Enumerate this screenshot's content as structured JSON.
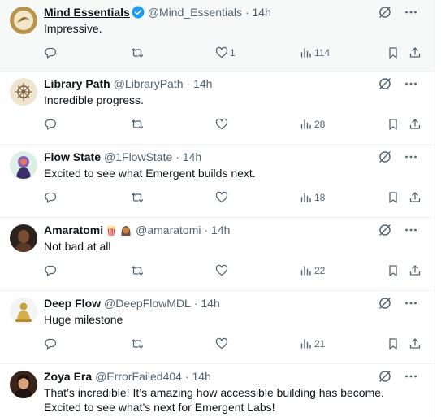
{
  "replies": [
    {
      "name": "Mind Essentials",
      "handle": "@Mind_Essentials",
      "time": "· 14h",
      "text": "Impressive.",
      "likes": "1",
      "views": "114",
      "verified": true
    },
    {
      "name": "Library Path",
      "handle": "@LibraryPath",
      "time": "· 14h",
      "text": "Incredible progress.",
      "likes": "",
      "views": "28"
    },
    {
      "name": "Flow State",
      "handle": "@1FlowState",
      "time": "· 14h",
      "text": "Excited to see what Emergent builds next.",
      "likes": "",
      "views": "18"
    },
    {
      "name": "Amaratomi",
      "handle": "@amaratomi",
      "time": "· 14h",
      "text": "Not bad at all",
      "likes": "",
      "views": "22"
    },
    {
      "name": "Deep Flow",
      "handle": "@DeepFlowMDL",
      "time": "· 14h",
      "text": "Huge milestone",
      "likes": "",
      "views": "21"
    },
    {
      "name": "Zoya Era",
      "handle": "@ErrorFailed404",
      "time": "· 14h",
      "text": "That’s incredible! It’s amazing how accessible building has become. Excited to see what’s next for Emergent Labs!"
    }
  ],
  "icons": {
    "reply": "reply-icon",
    "retweet": "retweet-icon",
    "like": "heart-icon",
    "views": "views-icon",
    "bookmark": "bookmark-icon",
    "share": "share-icon",
    "grok": "grok-icon",
    "more": "more-icon"
  },
  "colors": {
    "icon": "#536471",
    "verified": "#1d9bf0",
    "divider": "#eff3f4"
  }
}
